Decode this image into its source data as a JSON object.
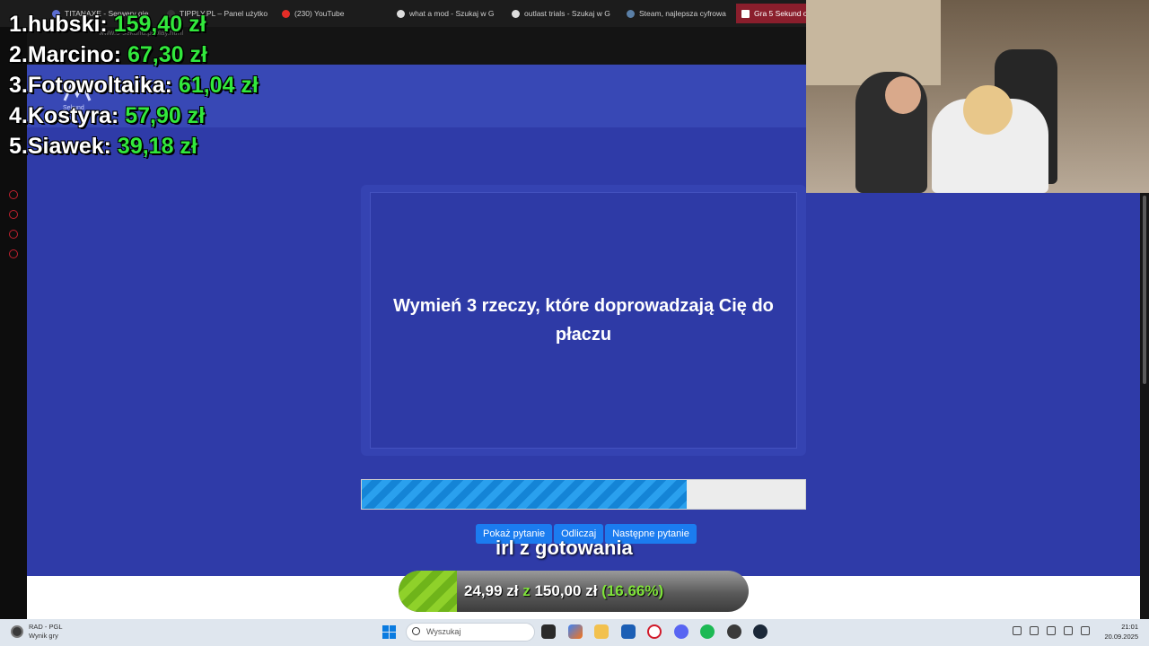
{
  "browser": {
    "tabs": [
      {
        "label": "TITANAXE - Serwery gier",
        "color": "#5b6dd1"
      },
      {
        "label": "TIPPLY.PL – Panel użytko",
        "color": "#333333"
      },
      {
        "label": "(230) YouTube",
        "color": "#e52d27"
      },
      {
        "label": "what a mod - Szukaj w G",
        "color": "#dddddd"
      },
      {
        "label": "outlast trials - Szukaj w G",
        "color": "#dddddd"
      },
      {
        "label": "Steam, najlepsza cyfrowa",
        "color": "#1b2838"
      },
      {
        "label": "Gra 5 Sekund o",
        "color": "#ffffff"
      }
    ],
    "address": "www.5-sekund.pl/play.html"
  },
  "site": {
    "logo_sub": "Sekund"
  },
  "leaderboard": [
    {
      "rank": "1.",
      "name": "hubski:",
      "amount": "159,40 zł"
    },
    {
      "rank": "2.",
      "name": "Marcino:",
      "amount": "67,30 zł"
    },
    {
      "rank": "3.",
      "name": "Fotowoltaika:",
      "amount": "61,04 zł"
    },
    {
      "rank": "4.",
      "name": "Kostyra:",
      "amount": "57,90 zł"
    },
    {
      "rank": "5.",
      "name": "Siawek:",
      "amount": "39,18 zł"
    }
  ],
  "game": {
    "question": "Wymień 3 rzeczy, które doprowadzają Cię do płaczu",
    "timer_progress": 0.733,
    "buttons": {
      "show": "Pokaż pytanie",
      "countdown": "Odliczaj",
      "next": "Następne pytanie"
    }
  },
  "stream": {
    "irl_text": "irl z gotowania",
    "goal": {
      "current": "24,99 zł",
      "separator": "z",
      "target": "150,00 zł",
      "percent": "(16.66%)",
      "progress": 0.1666
    }
  },
  "taskbar": {
    "left_title": "RAD - PGL",
    "left_sub": "Wynik gry",
    "search_placeholder": "Wyszukaj",
    "time": "21:01",
    "date": "20.09.2025",
    "accent": "#0a7be0"
  }
}
